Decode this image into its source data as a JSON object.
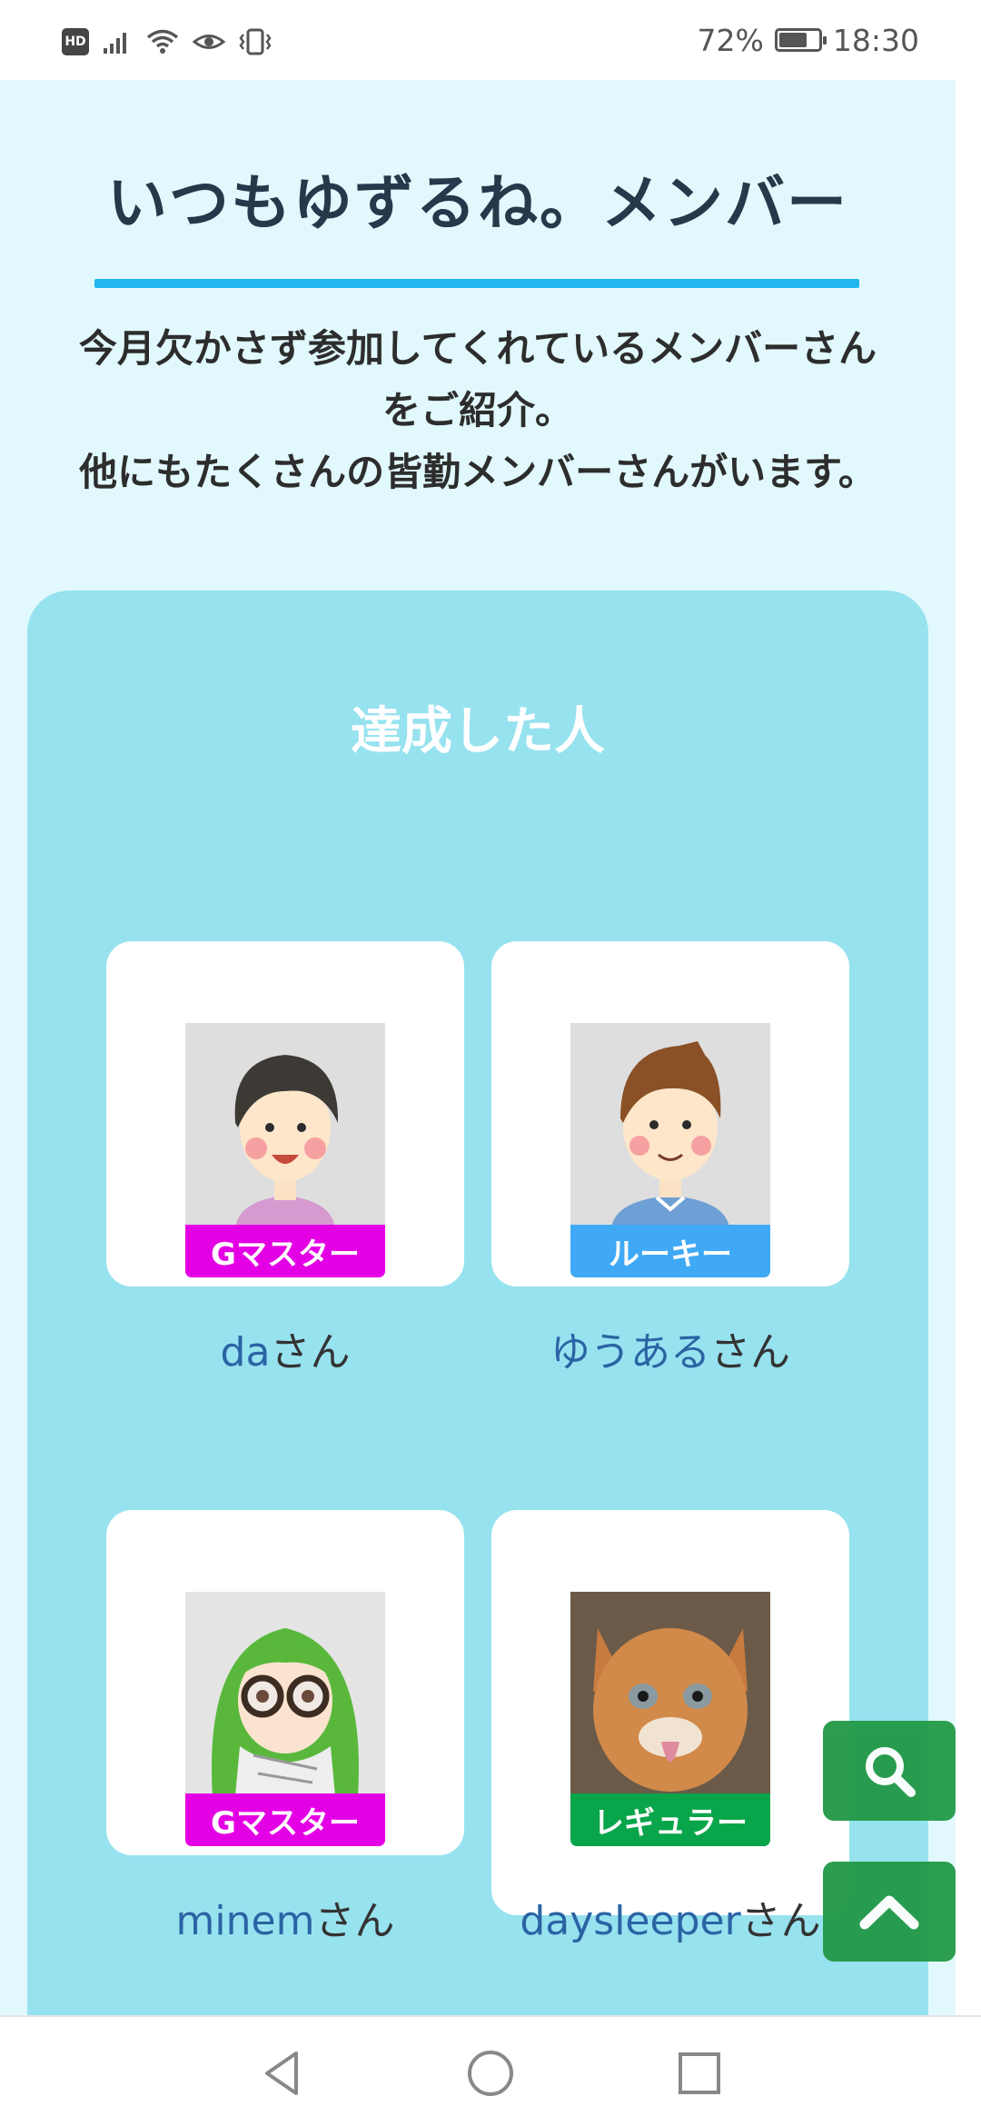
{
  "status_bar": {
    "hd_label": "HD",
    "battery_percent_text": "72%",
    "battery_level": 0.72,
    "time": "18:30",
    "icons": [
      "hd-icon",
      "signal-icon",
      "wifi-icon",
      "eye-icon",
      "vibrate-icon",
      "battery-icon"
    ]
  },
  "page": {
    "title": "いつもゆずるね。メンバー",
    "intro_line1": "今月欠かさず参加してくれているメンバーさん",
    "intro_line2": "をご紹介。",
    "intro_line3": "他にもたくさんの皆勤メンバーさんがいます。"
  },
  "panel": {
    "title": "達成した人",
    "members": [
      {
        "name": "da",
        "suffix": "さん",
        "rank": "Gマスター",
        "rank_color": "#e400e4",
        "avatar": "boy-black-hair-avatar"
      },
      {
        "name": "ゆうある",
        "suffix": "さん",
        "rank": "ルーキー",
        "rank_color": "#3fa9f5",
        "avatar": "boy-brown-hair-avatar"
      },
      {
        "name": "minem",
        "suffix": "さん",
        "rank": "Gマスター",
        "rank_color": "#e400e4",
        "avatar": "green-hair-glasses-avatar"
      },
      {
        "name": "daysleeper",
        "suffix": "さん",
        "rank": "レギュラー",
        "rank_color": "#08a54a",
        "avatar": "kitten-photo-avatar"
      }
    ]
  },
  "fab": {
    "search_icon": "search-icon",
    "scroll_top_icon": "chevron-up-icon",
    "color": "#249a48"
  },
  "nav_bar": {
    "icons": [
      "back-triangle-icon",
      "home-circle-icon",
      "recents-square-icon"
    ]
  },
  "colors": {
    "page_bg": "#e1f9fd",
    "panel_bg": "#97e2ef",
    "accent_rule": "#21b7ee",
    "title_text": "#24394a",
    "name_link": "#2a64a4"
  }
}
